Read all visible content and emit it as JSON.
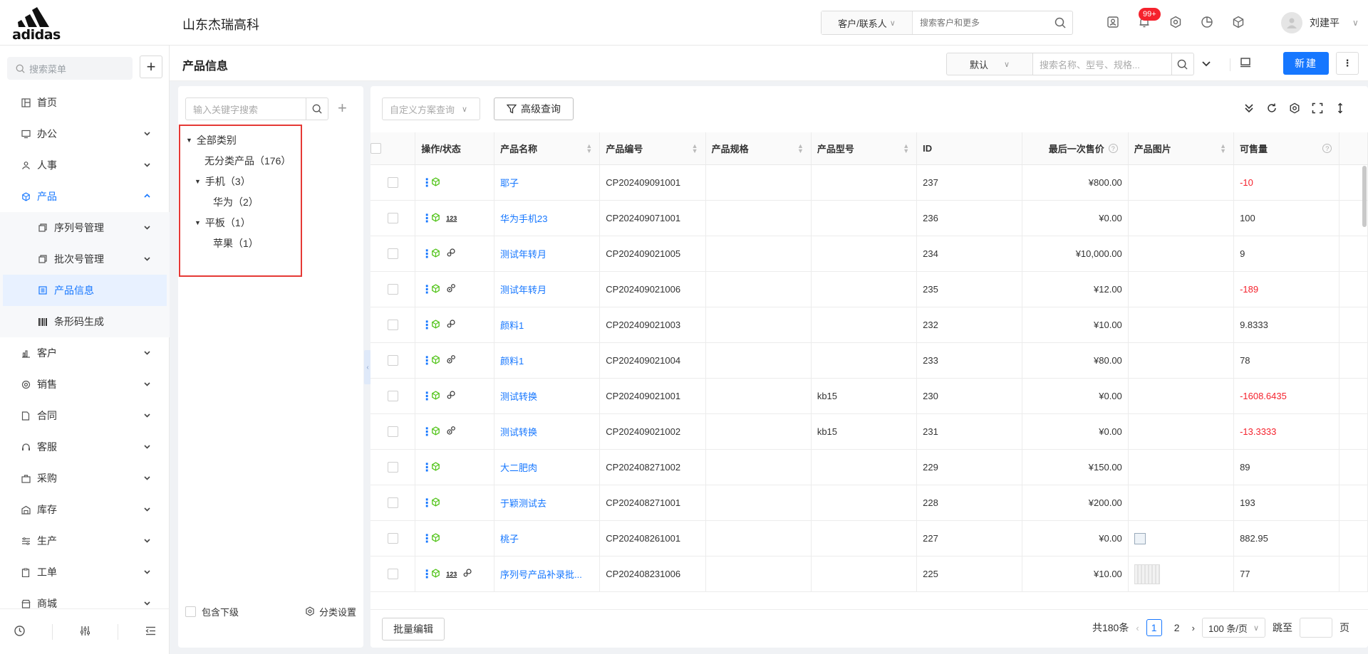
{
  "header": {
    "logo_text": "adidas",
    "company": "山东杰瑞高科",
    "search_scope": "客户/联系人",
    "search_placeholder": "搜索客户和更多",
    "notification_badge": "99+",
    "user_name": "刘建平"
  },
  "sidebar": {
    "search_placeholder": "搜索菜单",
    "items": [
      {
        "label": "首页"
      },
      {
        "label": "办公"
      },
      {
        "label": "人事"
      },
      {
        "label": "产品"
      },
      {
        "label": "客户"
      },
      {
        "label": "销售"
      },
      {
        "label": "合同"
      },
      {
        "label": "客服"
      },
      {
        "label": "采购"
      },
      {
        "label": "库存"
      },
      {
        "label": "生产"
      },
      {
        "label": "工单"
      },
      {
        "label": "商城"
      }
    ],
    "sub_items": [
      {
        "label": "序列号管理"
      },
      {
        "label": "批次号管理"
      },
      {
        "label": "产品信息"
      },
      {
        "label": "条形码生成"
      }
    ]
  },
  "page": {
    "title": "产品信息",
    "filter_default": "默认",
    "filter_placeholder": "搜索名称、型号、规格...",
    "new_button": "新建"
  },
  "category": {
    "search_placeholder": "输入关键字搜索",
    "tree": [
      {
        "label": "全部类别"
      },
      {
        "label": "无分类产品（176）"
      },
      {
        "label": "手机（3）"
      },
      {
        "label": "华为（2）"
      },
      {
        "label": "平板（1）"
      },
      {
        "label": "苹果（1）"
      }
    ],
    "include_sub": "包含下级",
    "settings": "分类设置"
  },
  "table": {
    "custom_scheme_placeholder": "自定义方案查询",
    "advanced_query": "高级查询",
    "columns": {
      "op": "操作/状态",
      "name": "产品名称",
      "code": "产品编号",
      "spec": "产品规格",
      "model": "产品型号",
      "id": "ID",
      "price": "最后一次售价",
      "img": "产品图片",
      "qty": "可售量"
    },
    "rows": [
      {
        "name": "耶子",
        "code": "CP202409091001",
        "spec": "",
        "model": "",
        "id": "237",
        "price": "¥800.00",
        "qty": "-10",
        "neg": true,
        "tag123": false,
        "gear": "none",
        "img": "none"
      },
      {
        "name": "华为手机23",
        "code": "CP202409071001",
        "spec": "",
        "model": "",
        "id": "236",
        "price": "¥0.00",
        "qty": "100",
        "neg": false,
        "tag123": true,
        "gear": "none",
        "img": "none"
      },
      {
        "name": "测试年转月",
        "code": "CP202409021005",
        "spec": "",
        "model": "",
        "id": "234",
        "price": "¥10,000.00",
        "qty": "9",
        "neg": false,
        "tag123": false,
        "gear": "link",
        "img": "none"
      },
      {
        "name": "测试年转月",
        "code": "CP202409021006",
        "spec": "",
        "model": "",
        "id": "235",
        "price": "¥12.00",
        "qty": "-189",
        "neg": true,
        "tag123": false,
        "gear": "gears",
        "img": "none"
      },
      {
        "name": "颜料1",
        "code": "CP202409021003",
        "spec": "",
        "model": "",
        "id": "232",
        "price": "¥10.00",
        "qty": "9.8333",
        "neg": false,
        "tag123": false,
        "gear": "link",
        "img": "none"
      },
      {
        "name": "颜料1",
        "code": "CP202409021004",
        "spec": "",
        "model": "",
        "id": "233",
        "price": "¥80.00",
        "qty": "78",
        "neg": false,
        "tag123": false,
        "gear": "gears",
        "img": "none"
      },
      {
        "name": "测试转换",
        "code": "CP202409021001",
        "spec": "",
        "model": "kb15",
        "id": "230",
        "price": "¥0.00",
        "qty": "-1608.6435",
        "neg": true,
        "tag123": false,
        "gear": "link",
        "img": "none"
      },
      {
        "name": "测试转换",
        "code": "CP202409021002",
        "spec": "",
        "model": "kb15",
        "id": "231",
        "price": "¥0.00",
        "qty": "-13.3333",
        "neg": true,
        "tag123": false,
        "gear": "gears",
        "img": "none"
      },
      {
        "name": "大二肥肉",
        "code": "CP202408271002",
        "spec": "",
        "model": "",
        "id": "229",
        "price": "¥150.00",
        "qty": "89",
        "neg": false,
        "tag123": false,
        "gear": "none",
        "img": "none"
      },
      {
        "name": "于颖测试去",
        "code": "CP202408271001",
        "spec": "",
        "model": "",
        "id": "228",
        "price": "¥200.00",
        "qty": "193",
        "neg": false,
        "tag123": false,
        "gear": "none",
        "img": "none"
      },
      {
        "name": "桃子",
        "code": "CP202408261001",
        "spec": "",
        "model": "",
        "id": "227",
        "price": "¥0.00",
        "qty": "882.95",
        "neg": false,
        "tag123": false,
        "gear": "none",
        "img": "broken"
      },
      {
        "name": "序列号产品补录批...",
        "code": "CP202408231006",
        "spec": "",
        "model": "",
        "id": "225",
        "price": "¥10.00",
        "qty": "77",
        "neg": false,
        "tag123": true,
        "gear": "link",
        "img": "thumb"
      }
    ],
    "batch_edit": "批量编辑",
    "total": "共180条",
    "pages": [
      "1",
      "2"
    ],
    "page_size": "100 条/页",
    "jump_label": "跳至",
    "page_unit": "页"
  },
  "colors": {
    "primary": "#1677ff",
    "negative": "#f5222d",
    "highlight_border": "#e53935"
  }
}
